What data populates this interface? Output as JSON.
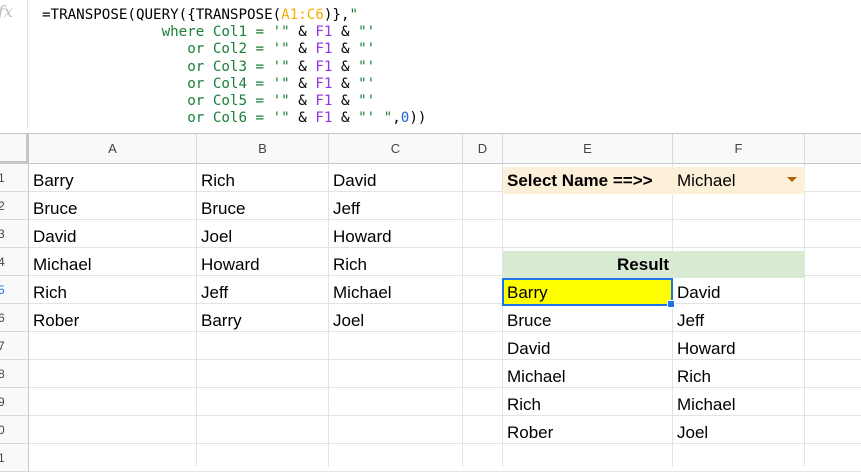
{
  "formula_bar": {
    "icon": "fx",
    "lines": [
      [
        {
          "t": "=TRANSPOSE(QUERY({TRANSPOSE("
        },
        {
          "t": "A1:C6",
          "c": "range"
        },
        {
          "t": ")},"
        },
        {
          "t": "\"",
          "c": "str"
        }
      ],
      [
        {
          "t": "              where Col1 = '\" ",
          "c": "str"
        },
        {
          "t": "& "
        },
        {
          "t": "F1",
          "c": "ref"
        },
        {
          "t": " & "
        },
        {
          "t": "\"'",
          "c": "str"
        }
      ],
      [
        {
          "t": "                 or Col2 = '\" ",
          "c": "str"
        },
        {
          "t": "& "
        },
        {
          "t": "F1",
          "c": "ref"
        },
        {
          "t": " & "
        },
        {
          "t": "\"'",
          "c": "str"
        }
      ],
      [
        {
          "t": "                 or Col3 = '\" ",
          "c": "str"
        },
        {
          "t": "& "
        },
        {
          "t": "F1",
          "c": "ref"
        },
        {
          "t": " & "
        },
        {
          "t": "\"'",
          "c": "str"
        }
      ],
      [
        {
          "t": "                 or Col4 = '\" ",
          "c": "str"
        },
        {
          "t": "& "
        },
        {
          "t": "F1",
          "c": "ref"
        },
        {
          "t": " & "
        },
        {
          "t": "\"'",
          "c": "str"
        }
      ],
      [
        {
          "t": "                 or Col5 = '\" ",
          "c": "str"
        },
        {
          "t": "& "
        },
        {
          "t": "F1",
          "c": "ref"
        },
        {
          "t": " & "
        },
        {
          "t": "\"'",
          "c": "str"
        }
      ],
      [
        {
          "t": "                 or Col6 = '\" ",
          "c": "str"
        },
        {
          "t": "& "
        },
        {
          "t": "F1",
          "c": "ref"
        },
        {
          "t": " & "
        },
        {
          "t": "\"' \"",
          "c": "str"
        },
        {
          "t": ","
        },
        {
          "t": "0",
          "c": "num"
        },
        {
          "t": "))"
        }
      ]
    ]
  },
  "columns": [
    "A",
    "B",
    "C",
    "D",
    "E",
    "F"
  ],
  "rows": [
    "1",
    "2",
    "3",
    "4",
    "5",
    "6",
    "7",
    "8",
    "9",
    "0",
    "1"
  ],
  "active_row": "5",
  "colors": {
    "range": "#f9ab00",
    "ref": "#9334e6",
    "str": "#188038",
    "num": "#1967d2",
    "selection": "#1a73e8",
    "highlight": "#ffff00",
    "result_bg": "#d9ead3",
    "select_bg": "#fdf0d8"
  },
  "data_table": [
    [
      "Barry",
      "Rich",
      "David"
    ],
    [
      "Bruce",
      "Bruce",
      "Jeff"
    ],
    [
      "David",
      "Joel",
      "Howard"
    ],
    [
      "Michael",
      "Howard",
      "Rich"
    ],
    [
      "Rich",
      "Jeff",
      "Michael"
    ],
    [
      "Rober",
      "Barry",
      "Joel"
    ]
  ],
  "select_label": "Select Name ==>>",
  "select_value": "Michael",
  "result_header": "Result",
  "result_table": [
    [
      "Barry",
      "David"
    ],
    [
      "Bruce",
      "Jeff"
    ],
    [
      "David",
      "Howard"
    ],
    [
      "Michael",
      "Rich"
    ],
    [
      "Rich",
      "Michael"
    ],
    [
      "Rober",
      "Joel"
    ]
  ]
}
